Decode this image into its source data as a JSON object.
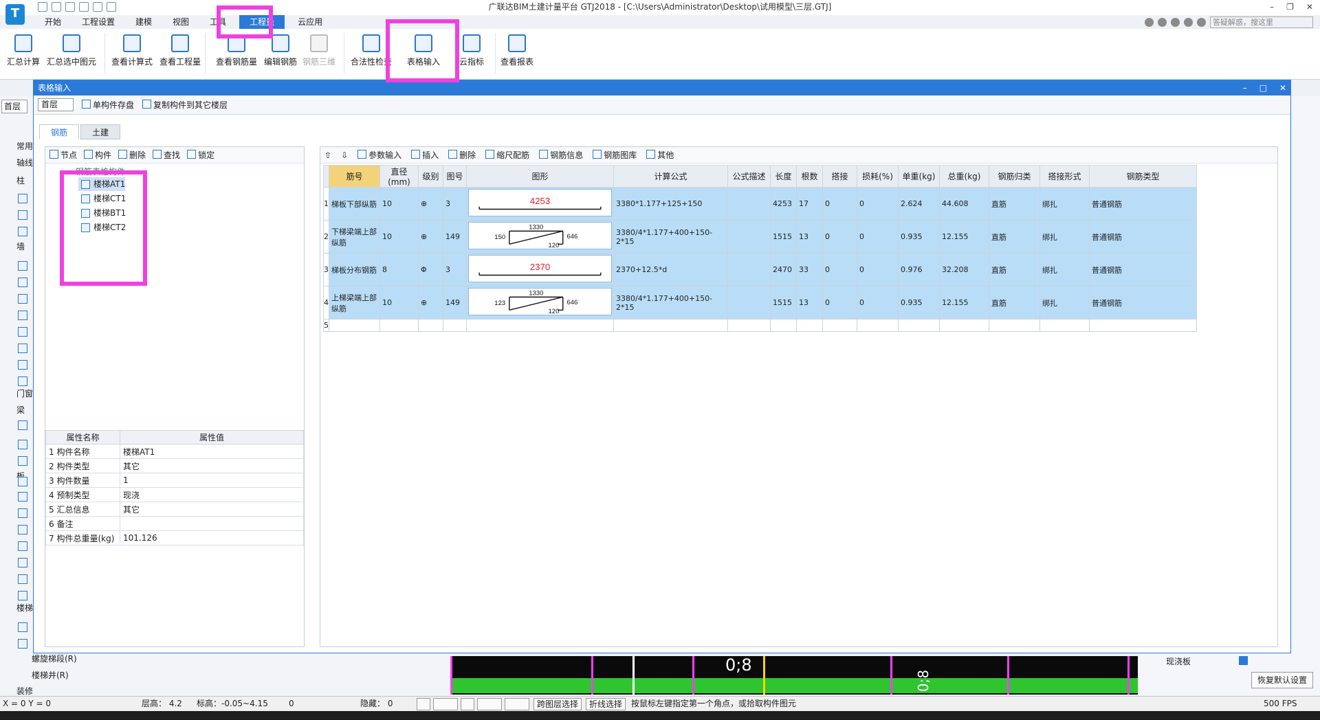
{
  "window": {
    "title": "广联达BIM土建计量平台 GTJ2018 - [C:\\Users\\Administrator\\Desktop\\试用模型\\三层.GTJ]"
  },
  "menu": [
    "开始",
    "工程设置",
    "建模",
    "视图",
    "工具",
    "工程量",
    "云应用"
  ],
  "menu_active": "工程量",
  "search_placeholder": "答疑解惑，搜这里",
  "ribbon": [
    {
      "label": "汇总计算",
      "icon": "sigma-icon"
    },
    {
      "label": "汇总选中图元",
      "icon": "summary-selected-icon"
    },
    {
      "label": "查看计算式",
      "icon": "view-formula-icon"
    },
    {
      "label": "查看工程量",
      "icon": "view-quantity-icon"
    },
    {
      "label": "查看钢筋量",
      "icon": "view-rebar-icon"
    },
    {
      "label": "编辑钢筋",
      "icon": "edit-rebar-icon"
    },
    {
      "label": "钢筋三维",
      "icon": "rebar-3d-icon"
    },
    {
      "label": "合法性检查",
      "icon": "check-icon"
    },
    {
      "label": "表格输入",
      "icon": "table-input-icon"
    },
    {
      "label": "云指标",
      "icon": "cloud-icon"
    },
    {
      "label": "查看报表",
      "icon": "report-icon"
    }
  ],
  "left_nav": {
    "floor": "首层",
    "items": [
      "常用",
      "轴线",
      "柱",
      "墙",
      "门窗",
      "梁",
      "板",
      "楼梯"
    ],
    "sub_items": [
      "螺旋梯段(R)",
      "楼梯井(R)",
      "装修"
    ]
  },
  "dialog": {
    "title": "表格输入",
    "floor": "首层",
    "save_label": "单构件存盘",
    "copy_label": "复制构件到其它楼层",
    "tabs": [
      "钢筋",
      "土建"
    ],
    "left_toolbar": [
      "节点",
      "构件",
      "删除",
      "查找",
      "锁定"
    ],
    "tree_root": "钢筋表格构件",
    "tree_items": [
      "楼梯AT1",
      "楼梯CT1",
      "楼梯BT1",
      "楼梯CT2"
    ],
    "prop_headers": [
      "属性名称",
      "属性值"
    ],
    "props": [
      {
        "n": "1",
        "name": "构件名称",
        "value": "楼梯AT1"
      },
      {
        "n": "2",
        "name": "构件类型",
        "value": "其它"
      },
      {
        "n": "3",
        "name": "构件数量",
        "value": "1"
      },
      {
        "n": "4",
        "name": "预制类型",
        "value": "现浇"
      },
      {
        "n": "5",
        "name": "汇总信息",
        "value": "其它"
      },
      {
        "n": "6",
        "name": "备注",
        "value": ""
      },
      {
        "n": "7",
        "name": "构件总重量(kg)",
        "value": "101.126"
      }
    ],
    "right_toolbar": [
      "参数输入",
      "插入",
      "删除",
      "缩尺配筋",
      "钢筋信息",
      "钢筋图库",
      "其他"
    ],
    "grid_headers": [
      "筋号",
      "直径(mm)",
      "级别",
      "图号",
      "图形",
      "计算公式",
      "公式描述",
      "长度",
      "根数",
      "搭接",
      "损耗(%)",
      "单重(kg)",
      "总重(kg)",
      "钢筋归类",
      "搭接形式",
      "钢筋类型"
    ],
    "rows": [
      {
        "n": "1",
        "name": "梯板下部纵筋",
        "dia": "10",
        "grade": "⊕",
        "fig": "3",
        "shape": {
          "type": "straight",
          "val": "4253"
        },
        "formula": "3380*1.177+125+150",
        "desc": "",
        "len": "4253",
        "count": "17",
        "lap": "0",
        "loss": "0",
        "unit": "2.624",
        "total": "44.608",
        "cls": "直筋",
        "lapform": "绑扎",
        "type": "普通钢筋"
      },
      {
        "n": "2",
        "name": "下梯梁端上部纵筋",
        "dia": "10",
        "grade": "⊕",
        "fig": "149",
        "shape": {
          "type": "bent",
          "l": "150",
          "t": "1330",
          "r": "646",
          "b": "120"
        },
        "formula": "3380/4*1.177+400+150-2*15",
        "desc": "",
        "len": "1515",
        "count": "13",
        "lap": "0",
        "loss": "0",
        "unit": "0.935",
        "total": "12.155",
        "cls": "直筋",
        "lapform": "绑扎",
        "type": "普通钢筋"
      },
      {
        "n": "3",
        "name": "梯板分布钢筋",
        "dia": "8",
        "grade": "Φ",
        "fig": "3",
        "shape": {
          "type": "straight",
          "val": "2370"
        },
        "formula": "2370+12.5*d",
        "desc": "",
        "len": "2470",
        "count": "33",
        "lap": "0",
        "loss": "0",
        "unit": "0.976",
        "total": "32.208",
        "cls": "直筋",
        "lapform": "绑扎",
        "type": "普通钢筋"
      },
      {
        "n": "4",
        "name": "上梯梁端上部纵筋",
        "dia": "10",
        "grade": "⊕",
        "fig": "149",
        "shape": {
          "type": "bent",
          "l": "123",
          "t": "1330",
          "r": "646",
          "b": "120"
        },
        "formula": "3380/4*1.177+400+150-2*15",
        "desc": "",
        "len": "1515",
        "count": "13",
        "lap": "0",
        "loss": "0",
        "unit": "0.935",
        "total": "12.155",
        "cls": "直筋",
        "lapform": "绑扎",
        "type": "普通钢筋"
      }
    ],
    "empty_row": "5"
  },
  "right_panel": {
    "item": "现浇板",
    "restore": "恢复默认设置"
  },
  "status": {
    "coords": "X = 0 Y = 0",
    "height": "层高：  4.2",
    "elev": "标高：-0.05~4.15",
    "zero": "0",
    "hidden": "隐藏：  0",
    "cross": "跨图层选择",
    "polyline": "折线选择",
    "hint": "按鼠标左键指定第一个角点，或拾取构件图元",
    "fps": "500 FPS"
  },
  "cad_labels": [
    "0;8",
    "0;8"
  ],
  "colors": {
    "accent": "#2b7ad8",
    "highlight": "#f040e0",
    "row_bg": "#b9ddf7",
    "cad_green": "#2ec52e"
  }
}
